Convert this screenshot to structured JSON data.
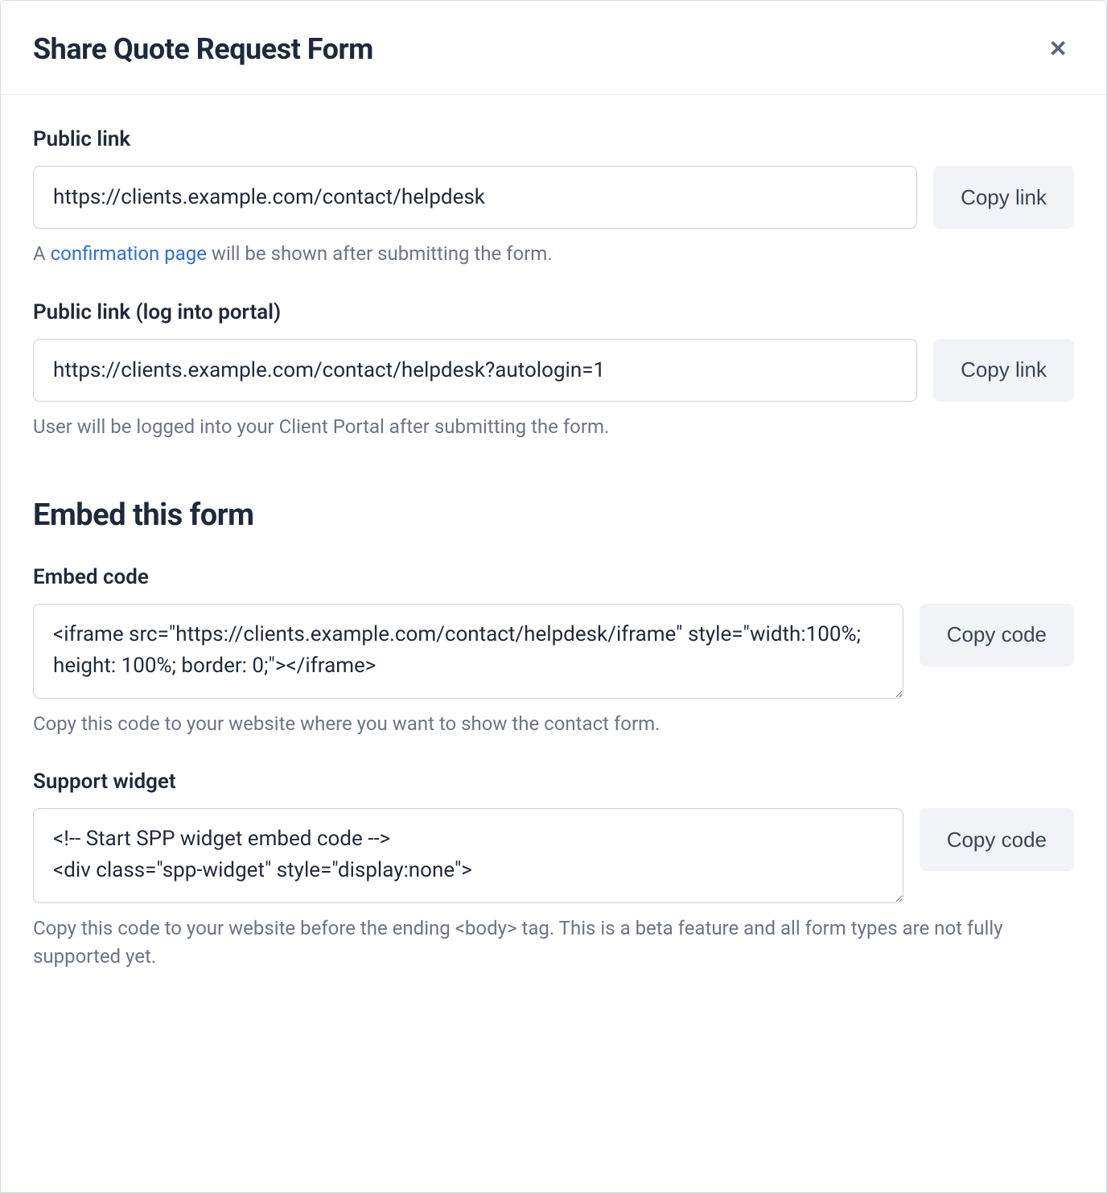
{
  "modal": {
    "title": "Share Quote Request Form"
  },
  "publicLink": {
    "label": "Public link",
    "value": "https://clients.example.com/contact/helpdesk",
    "copy": "Copy link",
    "help_prefix": "A ",
    "help_link": "confirmation page",
    "help_suffix": " will be shown after submitting the form."
  },
  "publicLinkLogin": {
    "label": "Public link (log into portal)",
    "value": "https://clients.example.com/contact/helpdesk?autologin=1",
    "copy": "Copy link",
    "help": "User will be logged into your Client Portal after submitting the form."
  },
  "embedSection": {
    "heading": "Embed this form"
  },
  "embedCode": {
    "label": "Embed code",
    "value": "<iframe src=\"https://clients.example.com/contact/helpdesk/iframe\" style=\"width:100%; height: 100%; border: 0;\"></iframe>",
    "copy": "Copy code",
    "help": "Copy this code to your website where you want to show the contact form."
  },
  "supportWidget": {
    "label": "Support widget",
    "value": "<!-- Start SPP widget embed code -->\n<div class=\"spp-widget\" style=\"display:none\">",
    "copy": "Copy code",
    "help": "Copy this code to your website before the ending <body> tag. This is a beta feature and all form types are not fully supported yet."
  }
}
